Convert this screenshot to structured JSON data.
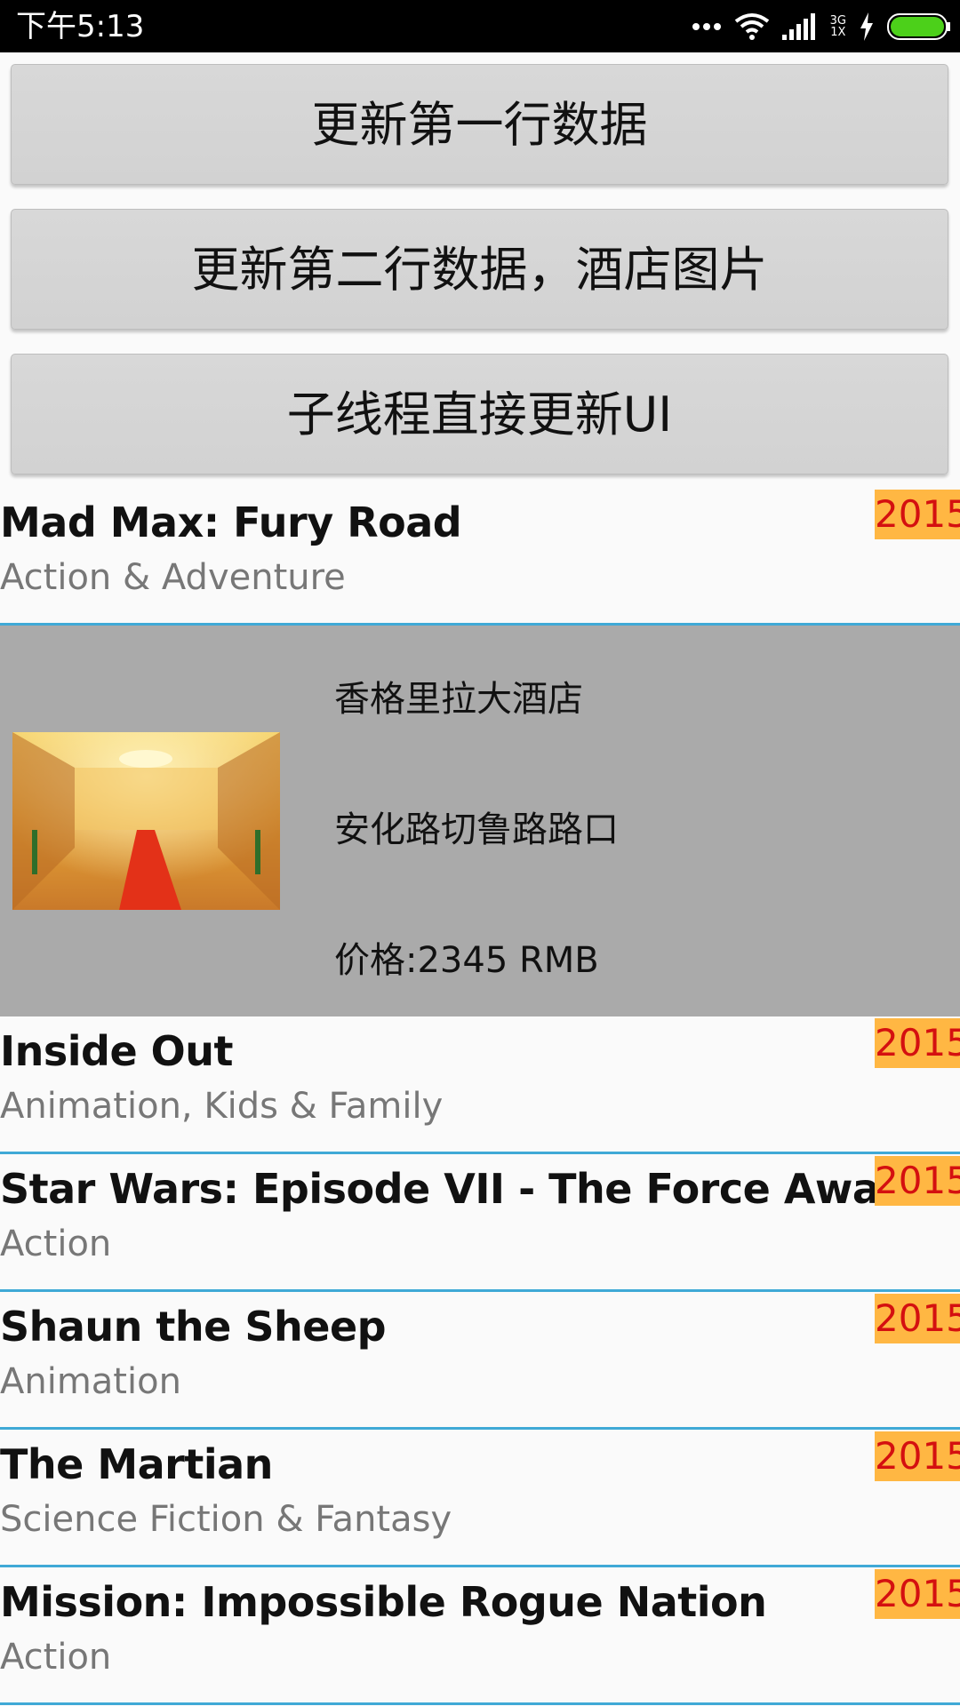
{
  "status_bar": {
    "time": "下午5:13",
    "network_top": "3G",
    "network_bottom": "1X"
  },
  "buttons": {
    "update_row1": "更新第一行数据",
    "update_row2": "更新第二行数据，酒店图片",
    "thread_update": "子线程直接更新UI"
  },
  "movies": [
    {
      "title": "Mad Max: Fury Road",
      "genre": "Action & Adventure",
      "year": "2015"
    },
    {
      "title": "Inside Out",
      "genre": "Animation, Kids & Family",
      "year": "2015"
    },
    {
      "title": "Star Wars: Episode VII - The Force Awakens",
      "genre": "Action",
      "year": "2015"
    },
    {
      "title": "Shaun the Sheep",
      "genre": "Animation",
      "year": "2015"
    },
    {
      "title": "The Martian",
      "genre": "Science Fiction & Fantasy",
      "year": "2015"
    },
    {
      "title": "Mission: Impossible Rogue Nation",
      "genre": "Action",
      "year": "2015"
    }
  ],
  "hotel": {
    "name": "香格里拉大酒店",
    "address": "安化路切鲁路路口",
    "price": "价格:2345 RMB"
  },
  "colors": {
    "divider": "#3fa9d6",
    "year_bg": "#ffb743",
    "year_text": "#d41010",
    "hotel_bg": "#aaaaaa",
    "battery": "#4cd01a"
  }
}
